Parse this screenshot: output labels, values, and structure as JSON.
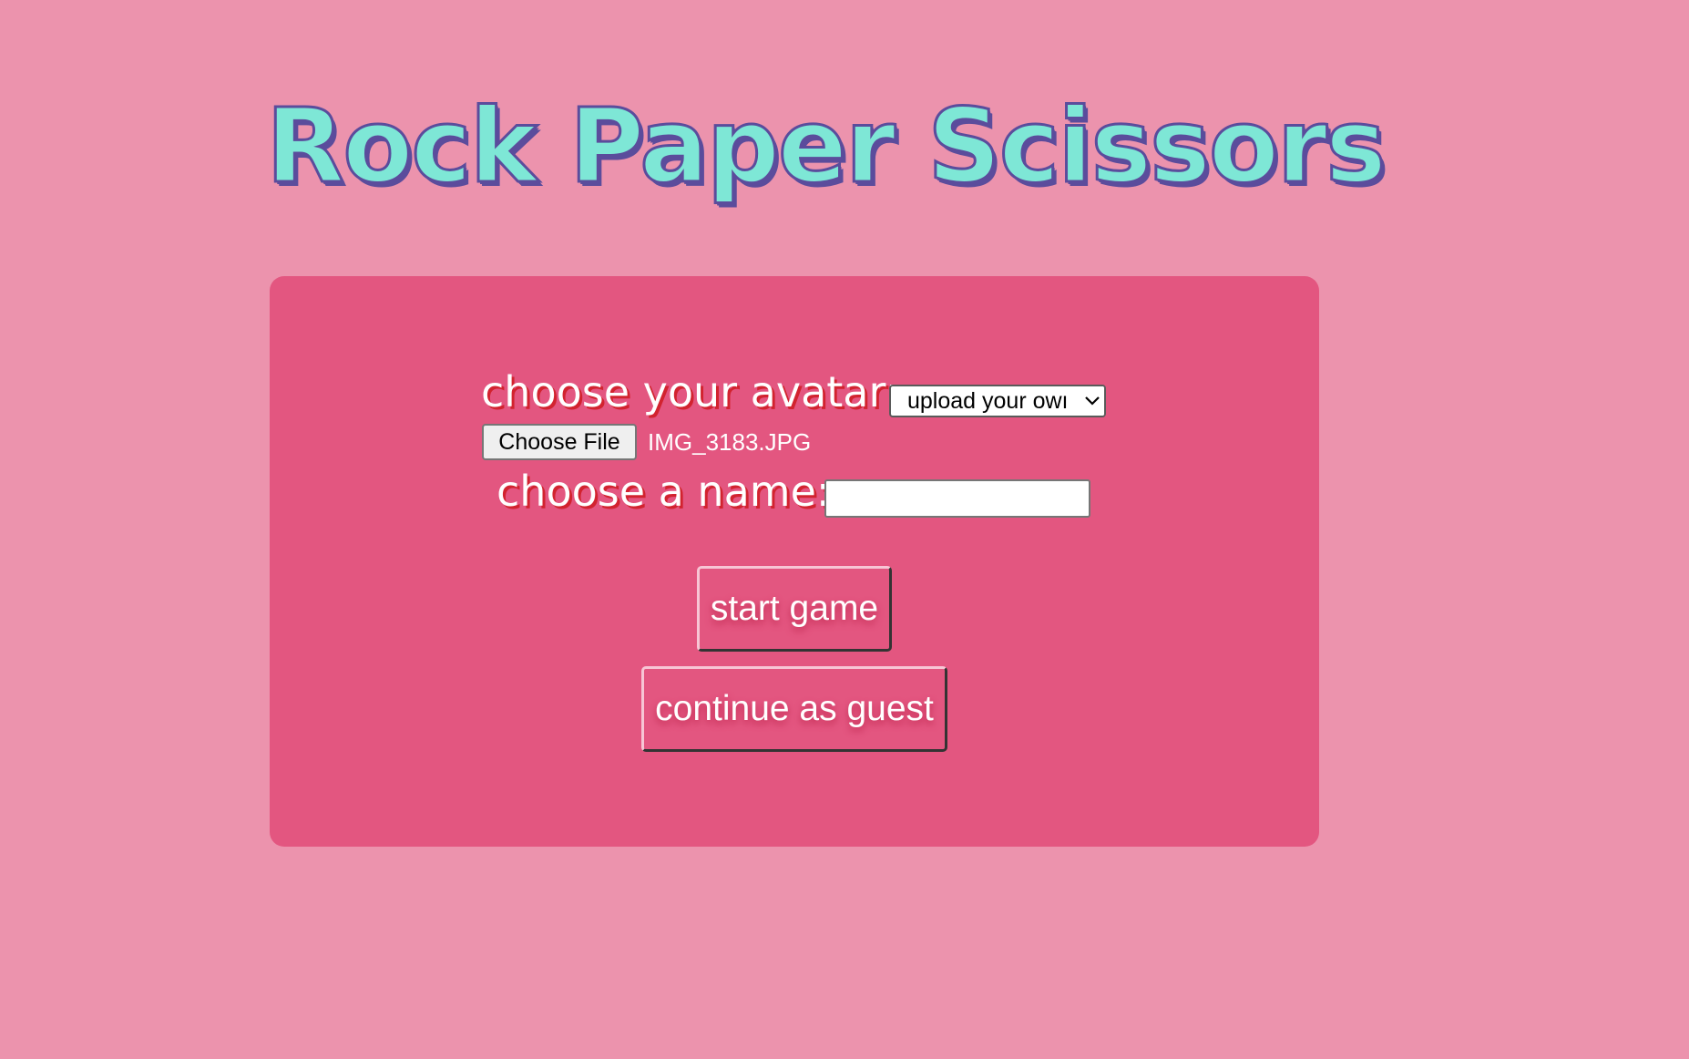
{
  "app": {
    "title": "Rock Paper Scissors"
  },
  "form": {
    "avatar_label": "choose your avatar:",
    "avatar_select": {
      "selected": "upload your own",
      "visible_text": "upload your owı"
    },
    "file_button_label": "Choose File",
    "file_name": "IMG_3183.JPG",
    "name_label": "choose a name:",
    "name_input_value": "",
    "start_button_label": "start game",
    "guest_button_label": "continue as guest"
  },
  "colors": {
    "page_background": "#ec93ad",
    "card_background": "#e35680",
    "title_fill": "#7ee7d6",
    "title_outline": "#5b4c9c",
    "label_shadow": "#d2232f"
  },
  "icons": {
    "select_arrow": "chevron-down-icon"
  }
}
